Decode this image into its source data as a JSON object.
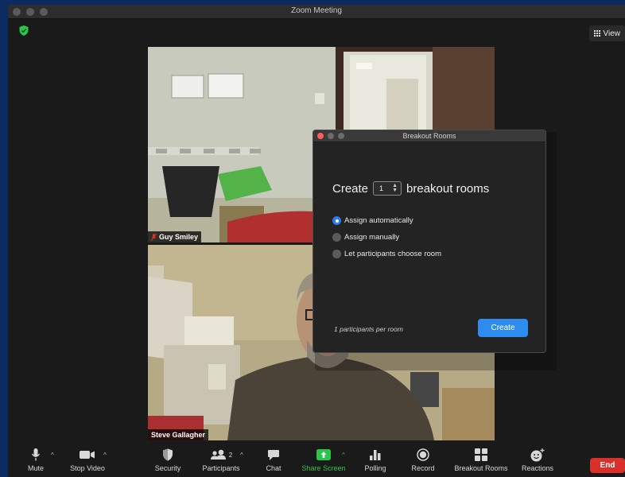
{
  "window": {
    "title": "Zoom Meeting"
  },
  "view_button": {
    "label": "View"
  },
  "participants": [
    {
      "name": "Guy Smiley",
      "muted": true
    },
    {
      "name": "Steve Gallagher",
      "muted": false
    }
  ],
  "breakout_dialog": {
    "title": "Breakout Rooms",
    "create_prefix": "Create",
    "room_count": "1",
    "create_suffix": "breakout rooms",
    "options": [
      {
        "label": "Assign automatically",
        "selected": true
      },
      {
        "label": "Assign manually",
        "selected": false
      },
      {
        "label": "Let participants choose room",
        "selected": false
      }
    ],
    "per_room_text": "1 participants per room",
    "create_button": "Create"
  },
  "toolbar": {
    "mute": "Mute",
    "stop_video": "Stop Video",
    "security": "Security",
    "participants": "Participants",
    "participants_count": "2",
    "chat": "Chat",
    "share_screen": "Share Screen",
    "polling": "Polling",
    "record": "Record",
    "breakout_rooms": "Breakout Rooms",
    "reactions": "Reactions",
    "end": "End"
  },
  "colors": {
    "accent_blue": "#2e8bef",
    "share_green": "#2bc54b",
    "end_red": "#d9302c",
    "security_green": "#2bc54b"
  }
}
